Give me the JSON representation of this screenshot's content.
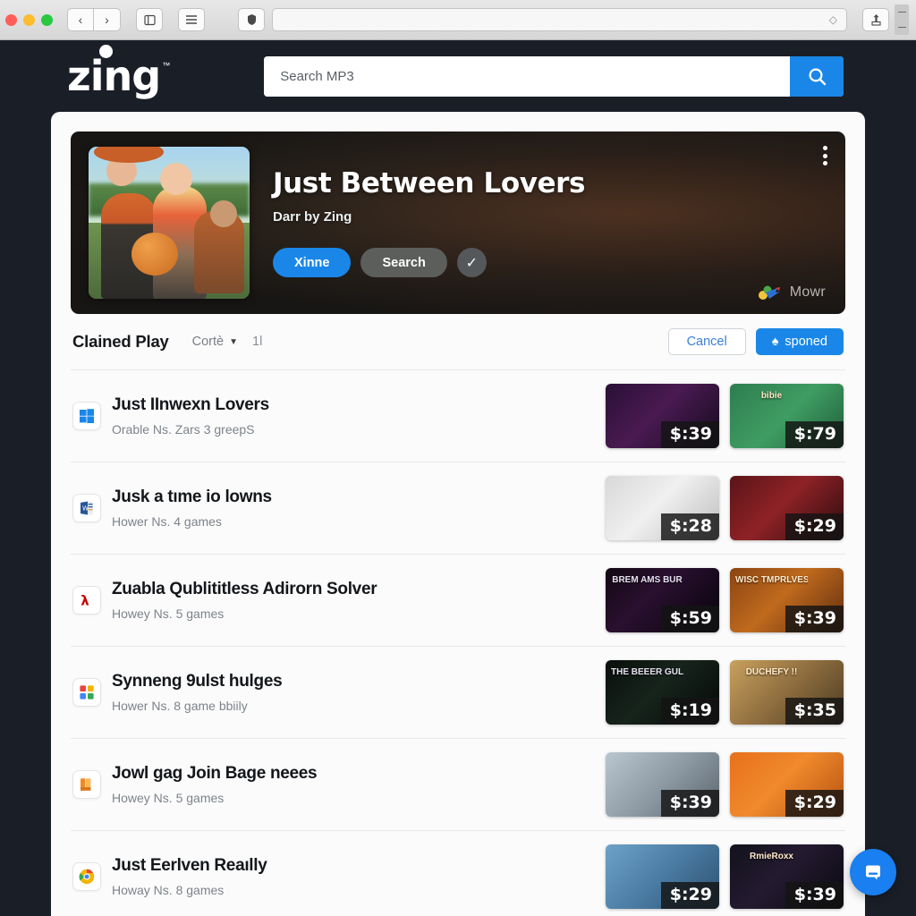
{
  "browser": {
    "back_icon": "chevron-left-icon",
    "forward_icon": "chevron-right-icon",
    "sidebar_icon": "sidebar-icon",
    "menu_icon": "hamburger-icon",
    "shield_icon": "shield-icon",
    "address_value": "",
    "address_placeholder": "",
    "reader_icon": "reader-icon",
    "share_icon": "share-icon"
  },
  "header": {
    "logo_text": "zing",
    "logo_tm": "™",
    "search": {
      "value": "",
      "placeholder": "Search MP3",
      "button_icon": "search-icon"
    }
  },
  "hero": {
    "title": "Just Between Lovers",
    "subtitle": "Darr by Zing",
    "buttons": [
      {
        "label": "Xinne",
        "style": "primary"
      },
      {
        "label": "Search",
        "style": "grey"
      }
    ],
    "check_icon": "check-icon",
    "kebab_icon": "more-vertical-icon",
    "brand_label": "Mowr",
    "brand_icon": "mowr-logo-icon"
  },
  "list_header": {
    "title": "Clained Play",
    "sort_label": "Cortè",
    "sort_caret_icon": "chevron-down-icon",
    "count": "1l",
    "cancel_label": "Cancel",
    "action_label": "sponed",
    "action_icon": "flame-icon"
  },
  "rows": [
    {
      "icon": "windows-icon",
      "title": "Just IInwexn Lovers",
      "subtitle": "Orable Ns. Zars 3 greepS",
      "thumbs": [
        {
          "price": "$:39",
          "caption": "",
          "bg": "linear-gradient(135deg,#2a1036,#4a1a52 45%,#120a1c)"
        },
        {
          "price": "$:79",
          "caption": "bibie",
          "bg": "linear-gradient(135deg,#2e7d4f,#3f9d62 50%,#1f5c39)"
        }
      ]
    },
    {
      "icon": "word-icon",
      "title": "Jusk a tıme io lowns",
      "subtitle": "Hower Ns. 4 games",
      "thumbs": [
        {
          "price": "$:28",
          "caption": "",
          "bg": "linear-gradient(135deg,#d8d8d8,#f0f0f0 45%,#bcbcbc)"
        },
        {
          "price": "$:29",
          "caption": "",
          "bg": "linear-gradient(135deg,#5b1418,#8e2226 45%,#2a0b0e)"
        }
      ]
    },
    {
      "icon": "acrobat-icon",
      "title": "Zuabla Qublititless Adirorn Solver",
      "subtitle": "Howey Ns. 5 games",
      "thumbs": [
        {
          "price": "$:59",
          "caption": "BREM AMS BUR",
          "bg": "linear-gradient(135deg,#120813,#2a1030 40%,#050308)"
        },
        {
          "price": "$:39",
          "caption": "WISC TMPRLVESG ULTIVRERS",
          "bg": "linear-gradient(135deg,#8a4412,#c06a1e 45%,#5e2c0c)"
        }
      ]
    },
    {
      "icon": "apps-grid-icon",
      "title": "Synneng 9ulst hulges",
      "subtitle": "Hower Ns. 8 game bbiily",
      "thumbs": [
        {
          "price": "$:19",
          "caption": "THE BEEER GULRTION",
          "bg": "linear-gradient(135deg,#0a0f0c,#16241c 45%,#050806)"
        },
        {
          "price": "$:35",
          "caption": "DUCHEFY !!",
          "bg": "linear-gradient(135deg,#c8a15e,#8d6c3e 50%,#4a3a22)"
        }
      ]
    },
    {
      "icon": "books-icon",
      "title": "Jowl gag Join Bage neees",
      "subtitle": "Howey Ns. 5 games",
      "thumbs": [
        {
          "price": "$:39",
          "caption": "",
          "bg": "linear-gradient(135deg,#b9c6cf,#8d9aa4 50%,#5a636b)"
        },
        {
          "price": "$:29",
          "caption": "",
          "bg": "linear-gradient(135deg,#e8701c,#f08a2c 45%,#b55010)"
        }
      ]
    },
    {
      "icon": "chrome-icon",
      "title": "Just Eerlven Reaılly",
      "subtitle": "Howay Ns. 8 games",
      "thumbs": [
        {
          "price": "$:29",
          "caption": "",
          "bg": "linear-gradient(135deg,#6ea2c9,#4a7ba3 50%,#2d4f6e)"
        },
        {
          "price": "$:39",
          "caption": "RmieRoxx",
          "bg": "linear-gradient(135deg,#12121c,#241a30 45%,#08080e)"
        }
      ]
    }
  ],
  "chat": {
    "icon": "chat-bubble-icon"
  },
  "colors": {
    "accent": "#1a87e8",
    "page_bg": "#1a1e27",
    "card_bg": "#fbfbfb"
  }
}
